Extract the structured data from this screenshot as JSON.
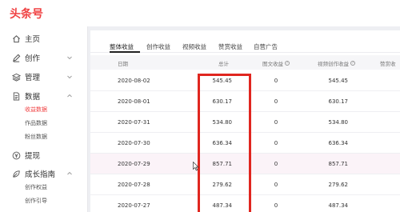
{
  "app": {
    "logo_text": "头条号"
  },
  "sidebar": {
    "items": [
      {
        "label": "主页",
        "icon": "home-icon"
      },
      {
        "label": "创作",
        "icon": "edit-icon"
      },
      {
        "label": "管理",
        "icon": "layers-icon"
      },
      {
        "label": "数据",
        "icon": "document-icon"
      },
      {
        "label": "提现",
        "icon": "yen-icon"
      },
      {
        "label": "成长指南",
        "icon": "growth-icon"
      }
    ],
    "data_subitems": [
      {
        "label": "收益数据",
        "active": true
      },
      {
        "label": "作品数据",
        "active": false
      },
      {
        "label": "粉丝数据",
        "active": false
      }
    ],
    "growth_subitems": [
      {
        "label": "创作权益"
      },
      {
        "label": "创作引导"
      }
    ]
  },
  "tabs": [
    "整体收益",
    "创作收益",
    "视频收益",
    "赞赏收益",
    "自营广告"
  ],
  "table": {
    "headers": {
      "date": "日期",
      "total": "总计",
      "image_text": "图文收益",
      "video_creation": "视频创作收益",
      "reward": "赞赏收"
    },
    "rows": [
      {
        "date": "2020-08-02",
        "total": "545.45",
        "image_text": "0",
        "video_creation": "545.45"
      },
      {
        "date": "2020-08-01",
        "total": "630.17",
        "image_text": "0",
        "video_creation": "630.17"
      },
      {
        "date": "2020-07-31",
        "total": "534.80",
        "image_text": "0",
        "video_creation": "534.80"
      },
      {
        "date": "2020-07-30",
        "total": "636.34",
        "image_text": "0",
        "video_creation": "636.34"
      },
      {
        "date": "2020-07-29",
        "total": "857.71",
        "image_text": "0",
        "video_creation": "857.71"
      },
      {
        "date": "2020-07-28",
        "total": "279.62",
        "image_text": "0",
        "video_creation": "279.62"
      },
      {
        "date": "2020-07-27",
        "total": "487.34",
        "image_text": "0",
        "video_creation": "487.34"
      }
    ]
  },
  "colors": {
    "brand": "#f04142",
    "annotation": "#e0261f",
    "highlight_row": "#fbf3f8"
  }
}
